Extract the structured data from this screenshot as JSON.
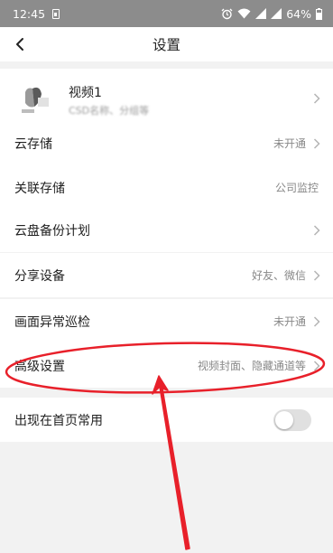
{
  "status_bar": {
    "time": "12:45",
    "battery": "64%"
  },
  "nav": {
    "title": "设置"
  },
  "device": {
    "name": "视频1",
    "subtitle": "CSD名称、分组等"
  },
  "rows": {
    "cloud_storage": {
      "label": "云存储",
      "value": "未开通"
    },
    "linked_storage": {
      "label": "关联存储",
      "value": "公司监控"
    },
    "cloud_backup": {
      "label": "云盘备份计划"
    },
    "share_device": {
      "label": "分享设备",
      "value": "好友、微信"
    },
    "anomaly_patrol": {
      "label": "画面异常巡检",
      "value": "未开通"
    },
    "advanced_settings": {
      "label": "高级设置",
      "value": "视频封面、隐藏通道等"
    },
    "show_on_home": {
      "label": "出现在首页常用",
      "toggle_on": false
    }
  },
  "annotation_color": "#e8202a"
}
